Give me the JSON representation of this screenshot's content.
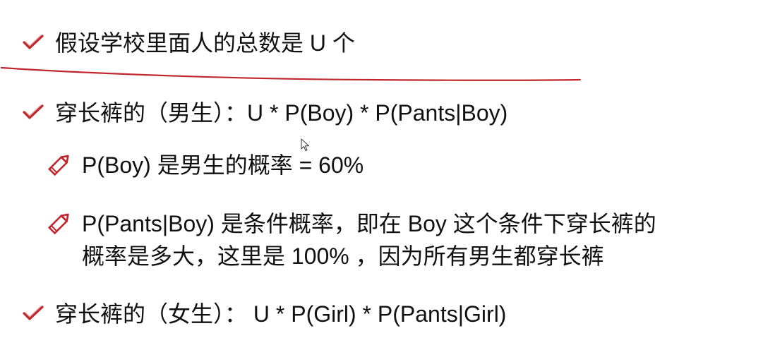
{
  "slide": {
    "items": [
      {
        "text": "假设学校里面人的总数是 U 个"
      },
      {
        "text": "穿长裤的（男生）：U * P(Boy) * P(Pants|Boy)"
      },
      {
        "text": "穿长裤的（女生）： U * P(Girl) * P(Pants|Girl)"
      }
    ],
    "subitems": [
      {
        "text": "P(Boy) 是男生的概率 = 60%"
      },
      {
        "text_line1": "P(Pants|Boy) 是条件概率，即在 Boy 这个条件下穿长裤的",
        "text_line2": "概率是多大，这里是 100% ，因为所有男生都穿长裤"
      }
    ]
  },
  "colors": {
    "accent": "#c0272d",
    "text": "#111111",
    "background": "#ffffff"
  },
  "icons": {
    "bullet": "check-icon",
    "sub_bullet": "pencil-icon",
    "pointer": "cursor-arrow-icon"
  }
}
